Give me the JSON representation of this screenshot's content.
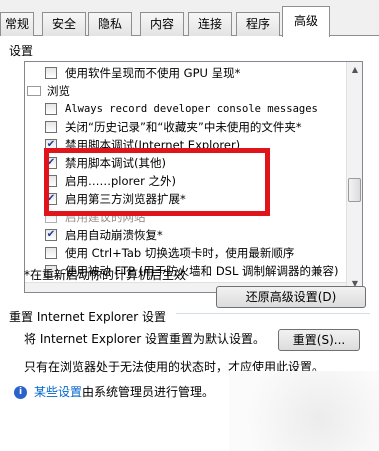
{
  "tabs": [
    {
      "label": "常规",
      "active": false
    },
    {
      "label": "安全",
      "active": false
    },
    {
      "label": "隐私",
      "active": false
    },
    {
      "label": "内容",
      "active": false
    },
    {
      "label": "连接",
      "active": false
    },
    {
      "label": "程序",
      "active": false
    },
    {
      "label": "高级",
      "active": true
    }
  ],
  "settings": {
    "label": "设置",
    "items": [
      {
        "kind": "checkbox",
        "checked": false,
        "text": "使用软件呈现而不使用 GPU 呈现*"
      },
      {
        "kind": "folder",
        "text": "浏览"
      },
      {
        "kind": "checkbox",
        "checked": false,
        "text": "Always record developer console messages"
      },
      {
        "kind": "checkbox",
        "checked": false,
        "text": "关闭“历史记录”和“收藏夹”中未使用的文件夹*"
      },
      {
        "kind": "checkbox",
        "checked": true,
        "text": "禁用脚本调试(Internet Explorer)"
      },
      {
        "kind": "checkbox",
        "checked": true,
        "text": "禁用脚本调试(其他)"
      },
      {
        "kind": "checkbox",
        "checked": false,
        "text": "启用……plorer 之外)"
      },
      {
        "kind": "checkbox",
        "checked": true,
        "text": "启用第三方浏览器扩展*"
      },
      {
        "kind": "checkbox",
        "checked": false,
        "text": "启用建议的网站",
        "disabled": true
      },
      {
        "kind": "checkbox",
        "checked": true,
        "text": "启用自动崩溃恢复*"
      },
      {
        "kind": "checkbox",
        "checked": false,
        "text": "使用 Ctrl+Tab 切换选项卡时，使用最新顺序"
      },
      {
        "kind": "checkbox",
        "checked": false,
        "text": "使用被动 FTP (用于防火墙和 DSL 调制解调器的兼容)"
      }
    ],
    "restart_note": "*在重新启动你的计算机后生效",
    "restore_button": "还原高级设置(D)"
  },
  "reset": {
    "group_label": "重置 Internet Explorer 设置",
    "description": "将 Internet Explorer 设置重置为默认设置。",
    "button": "重置(S)...",
    "condition_note": "只有在浏览器处于无法使用的状态时，才应使用此设置。"
  },
  "info": {
    "icon": "info-icon",
    "link_text": "某些设置",
    "rest_text": "由系统管理员进行管理。"
  },
  "colors": {
    "highlight": "#e0141b",
    "link": "#0066cc",
    "check": "#1c3f94"
  }
}
